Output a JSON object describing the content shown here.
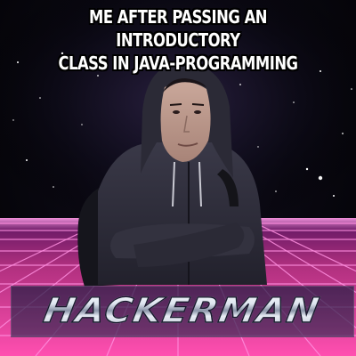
{
  "caption": {
    "line1": "ME AFTER PASSING AN INTRODUCTORY",
    "line2": "CLASS IN JAVA-PROGRAMMING"
  },
  "logo": {
    "text": "HACKERMAN"
  },
  "colors": {
    "caption_text": "#ffffff",
    "grid_line": "#ff6ad5",
    "floor_top": "#7a1e7a",
    "floor_bottom": "#ff4fb0",
    "logo_chrome": "#d7dde8"
  }
}
